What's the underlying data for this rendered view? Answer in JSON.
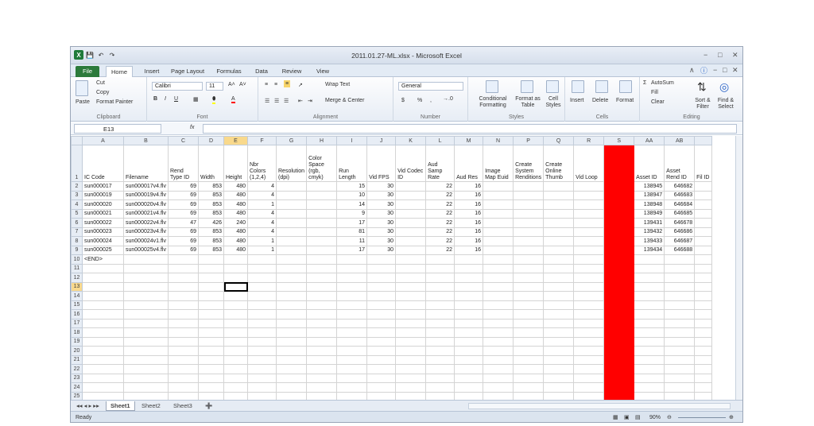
{
  "app": {
    "title": "2011.01.27-ML.xlsx - Microsoft Excel"
  },
  "ribbon_tabs": [
    "File",
    "Home",
    "Insert",
    "Page Layout",
    "Formulas",
    "Data",
    "Review",
    "View"
  ],
  "ribbon": {
    "clipboard": {
      "paste": "Paste",
      "cut": "Cut",
      "copy": "Copy",
      "format_painter": "Format Painter",
      "label": "Clipboard"
    },
    "font": {
      "name": "Calibri",
      "size": "11",
      "label": "Font",
      "bold": "B",
      "italic": "I",
      "underline": "U"
    },
    "alignment": {
      "wrap_text": "Wrap Text",
      "merge_center": "Merge & Center",
      "label": "Alignment"
    },
    "number": {
      "format": "General",
      "currency": "$",
      "percent": "%",
      "comma": ",",
      "label": "Number"
    },
    "styles": {
      "conditional": "Conditional Formatting",
      "format_table": "Format as Table",
      "cell_styles": "Cell Styles",
      "label": "Styles"
    },
    "cells": {
      "insert": "Insert",
      "delete": "Delete",
      "format": "Format",
      "label": "Cells"
    },
    "editing": {
      "autosum": "AutoSum",
      "fill": "Fill",
      "clear": "Clear",
      "sort_filter": "Sort & Filter",
      "find_select": "Find & Select",
      "label": "Editing"
    }
  },
  "formula_bar": {
    "name_box": "E13",
    "fx": "fx",
    "formula": ""
  },
  "columns": [
    "A",
    "B",
    "C",
    "D",
    "E",
    "F",
    "G",
    "H",
    "I",
    "J",
    "K",
    "L",
    "M",
    "N",
    "P",
    "Q",
    "R",
    "S",
    "AA",
    "AB"
  ],
  "selected_column": "E",
  "header_row": [
    "IC Code",
    "Filename",
    "Rend Type ID",
    "Width",
    "Height",
    "Nbr Colors (1,2,4)",
    "Resolution (dpi)",
    "Color Space (rgb, cmyk)",
    "Run Length",
    "Vid FPS",
    "Vid Codec ID",
    "Aud Samp Rate",
    "Aud Res",
    "Image Map Euid",
    "Create System Renditions",
    "Create Online Thumb",
    "Vid Loop",
    "",
    "Asset ID",
    "Asset Rend ID",
    "Fil ID"
  ],
  "rows": [
    [
      "sun000017",
      "sun000017v4.flv",
      "69",
      "853",
      "480",
      "4",
      "",
      "",
      "15",
      "30",
      "",
      "22",
      "16",
      "",
      "",
      "",
      "",
      "",
      "138945",
      "646682"
    ],
    [
      "sun000019",
      "sun000019v4.flv",
      "69",
      "853",
      "480",
      "4",
      "",
      "",
      "10",
      "30",
      "",
      "22",
      "16",
      "",
      "",
      "",
      "",
      "",
      "138947",
      "646683"
    ],
    [
      "sun000020",
      "sun000020v4.flv",
      "69",
      "853",
      "480",
      "1",
      "",
      "",
      "14",
      "30",
      "",
      "22",
      "16",
      "",
      "",
      "",
      "",
      "",
      "138948",
      "646684"
    ],
    [
      "sun000021",
      "sun000021v4.flv",
      "69",
      "853",
      "480",
      "4",
      "",
      "",
      "9",
      "30",
      "",
      "22",
      "16",
      "",
      "",
      "",
      "",
      "",
      "138949",
      "646685"
    ],
    [
      "sun000022",
      "sun000022v4.flv",
      "47",
      "426",
      "240",
      "4",
      "",
      "",
      "17",
      "30",
      "",
      "22",
      "16",
      "",
      "",
      "",
      "",
      "",
      "139431",
      "646678"
    ],
    [
      "sun000023",
      "sun000023v4.flv",
      "69",
      "853",
      "480",
      "4",
      "",
      "",
      "81",
      "30",
      "",
      "22",
      "16",
      "",
      "",
      "",
      "",
      "",
      "139432",
      "646686"
    ],
    [
      "sun000024",
      "sun000024v1.flv",
      "69",
      "853",
      "480",
      "1",
      "",
      "",
      "11",
      "30",
      "",
      "22",
      "16",
      "",
      "",
      "",
      "",
      "",
      "139433",
      "646687"
    ],
    [
      "sun000025",
      "sun000025v4.flv",
      "69",
      "853",
      "480",
      "1",
      "",
      "",
      "17",
      "30",
      "",
      "22",
      "16",
      "",
      "",
      "",
      "",
      "",
      "139434",
      "646688"
    ],
    [
      "<END>",
      "",
      "",
      "",
      "",
      "",
      "",
      "",
      "",
      "",
      "",
      "",
      "",
      "",
      "",
      "",
      "",
      "",
      "",
      ""
    ]
  ],
  "row_numbers": [
    "1",
    "2",
    "3",
    "4",
    "5",
    "6",
    "7",
    "8",
    "9",
    "10",
    "11",
    "12",
    "13",
    "14",
    "15",
    "16",
    "17",
    "18",
    "19",
    "20",
    "21",
    "22",
    "23",
    "24",
    "25"
  ],
  "sheets": [
    "Sheet1",
    "Sheet2",
    "Sheet3"
  ],
  "active_sheet": "Sheet1",
  "status": {
    "mode": "Ready",
    "zoom": "90%"
  },
  "colors": {
    "highlight_column": "#ff0000",
    "file_tab": "#2c7a3b",
    "selected_header": "#f9d98c"
  }
}
